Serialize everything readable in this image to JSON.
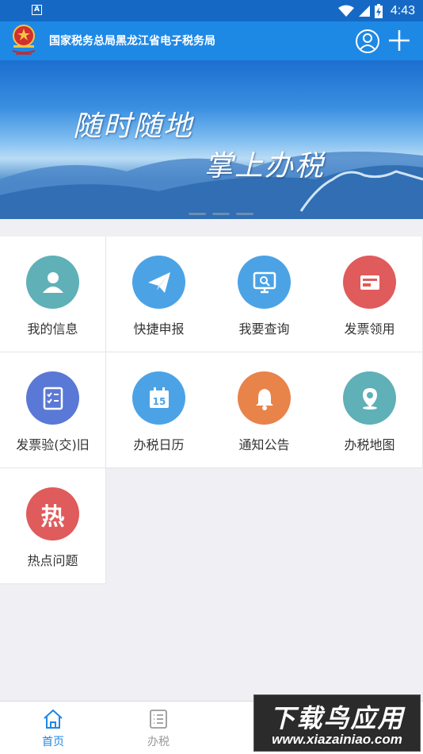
{
  "status_bar": {
    "sim_label": "A",
    "time": "4:43",
    "icons": [
      "wifi-icon",
      "cell-signal-icon",
      "battery-charging-icon"
    ]
  },
  "header": {
    "title": "国家税务总局黑龙江省电子税务局",
    "logo": "tax-bureau-emblem",
    "logo_caption": "中国税务",
    "background": "#1e88e5"
  },
  "banner": {
    "line1": "随时随地",
    "line2": "掌上办税",
    "slides": 3
  },
  "menu": {
    "items": [
      {
        "label": "我的信息",
        "icon": "person-icon",
        "color": "#5fb0b7"
      },
      {
        "label": "快捷申报",
        "icon": "paper-plane-icon",
        "color": "#4ba3e6"
      },
      {
        "label": "我要查询",
        "icon": "monitor-search-icon",
        "color": "#4ba3e6"
      },
      {
        "label": "发票领用",
        "icon": "invoice-card-icon",
        "color": "#e05b5b"
      },
      {
        "label": "发票验(交)旧",
        "icon": "checklist-icon",
        "color": "#5a78d6"
      },
      {
        "label": "办税日历",
        "icon": "calendar-icon",
        "color": "#4ba3e6"
      },
      {
        "label": "通知公告",
        "icon": "bell-icon",
        "color": "#e8834a"
      },
      {
        "label": "办税地图",
        "icon": "map-pin-icon",
        "color": "#5fb0b7"
      },
      {
        "label": "热点问题",
        "icon": "hot-topic-icon",
        "color": "#e05b5b",
        "glyph": "热"
      }
    ],
    "calendar_day": "15"
  },
  "tabbar": {
    "tabs": [
      {
        "label": "首页",
        "icon": "home-icon",
        "active": true,
        "color": "#1e88e5"
      },
      {
        "label": "办税",
        "icon": "list-icon",
        "active": false,
        "color": "#999999"
      }
    ]
  },
  "watermark": {
    "line1": "下载鸟应用",
    "line2": "www.xiazainiao.com"
  }
}
